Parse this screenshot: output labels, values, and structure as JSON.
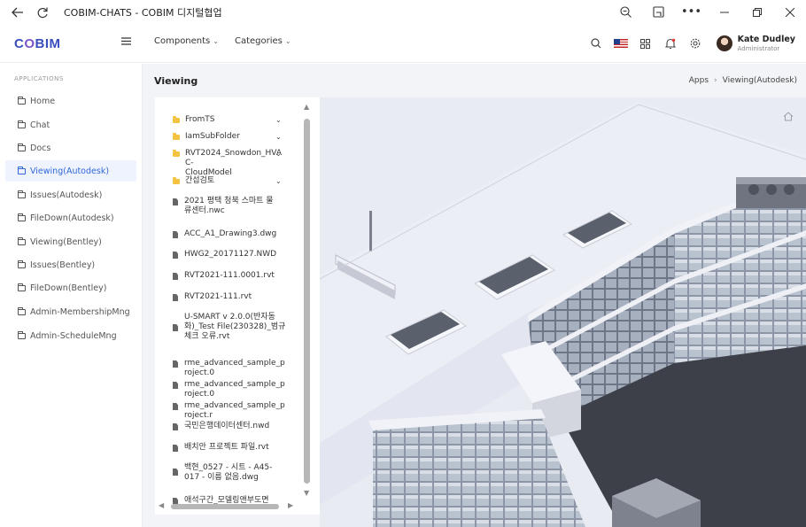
{
  "window": {
    "title": "COBIM-CHATS - COBIM 디지털협업",
    "controls": [
      "back-icon",
      "refresh-icon",
      "zoom-icon",
      "cast-icon",
      "more-icon",
      "minimize-icon",
      "restore-icon",
      "close-icon"
    ]
  },
  "header": {
    "logo_text_a": "C",
    "logo_text_oo": "O",
    "logo_text_b": "BIM",
    "menus": [
      {
        "label": "Components"
      },
      {
        "label": "Categories"
      }
    ],
    "user": {
      "name": "Kate Dudley",
      "role": "Administrator"
    }
  },
  "sidebar": {
    "section": "APPLICATIONS",
    "items": [
      {
        "label": "Home"
      },
      {
        "label": "Chat"
      },
      {
        "label": "Docs"
      },
      {
        "label": "Viewing(Autodesk)",
        "active": true
      },
      {
        "label": "Issues(Autodesk)"
      },
      {
        "label": "FileDown(Autodesk)"
      },
      {
        "label": "Viewing(Bentley)"
      },
      {
        "label": "Issues(Bentley)"
      },
      {
        "label": "FileDown(Bentley)"
      },
      {
        "label": "Admin-MembershipMng"
      },
      {
        "label": "Admin-ScheduleMng"
      }
    ]
  },
  "page": {
    "title": "Viewing",
    "breadcrumb": [
      "Apps",
      "Viewing(Autodesk)"
    ]
  },
  "tree": {
    "items": [
      {
        "type": "folder",
        "label": "FromTS"
      },
      {
        "type": "folder",
        "label": "IamSubFolder"
      },
      {
        "type": "folder",
        "label": "RVT2024_Snowdon_HVAC-\nCloudModel"
      },
      {
        "type": "folder",
        "label": "간섭검토"
      },
      {
        "type": "file",
        "label": "2021 평택 청북 스마트 물\n류센터.nwc"
      },
      {
        "type": "file",
        "label": "ACC_A1_Drawing3.dwg"
      },
      {
        "type": "file",
        "label": "HWG2_20171127.NWD"
      },
      {
        "type": "file",
        "label": "RVT2021-111.0001.rvt"
      },
      {
        "type": "file",
        "label": "RVT2021-111.rvt"
      },
      {
        "type": "file",
        "label": "U-SMART v 2.0.0(반자동\n화)_Test File(230328)_범규\n체크 오류.rvt"
      },
      {
        "type": "file",
        "label": "rme_advanced_sample_project.0"
      },
      {
        "type": "file",
        "label": "rme_advanced_sample_project.0"
      },
      {
        "type": "file",
        "label": "rme_advanced_sample_project.r"
      },
      {
        "type": "file",
        "label": "국민은행데이터센터.nwd"
      },
      {
        "type": "file",
        "label": "배치안 프로젝트 파일.rvt"
      },
      {
        "type": "file",
        "label": "백현_0527 - 시트 - A45-\n017 - 이름 없음.dwg"
      },
      {
        "type": "file",
        "label": "애석구간_모델링앤부도면"
      }
    ]
  },
  "colors": {
    "accent": "#3168d6",
    "active_bg": "#eef3fd",
    "folder": "#f5c342",
    "logo": "#3a4dbd"
  }
}
